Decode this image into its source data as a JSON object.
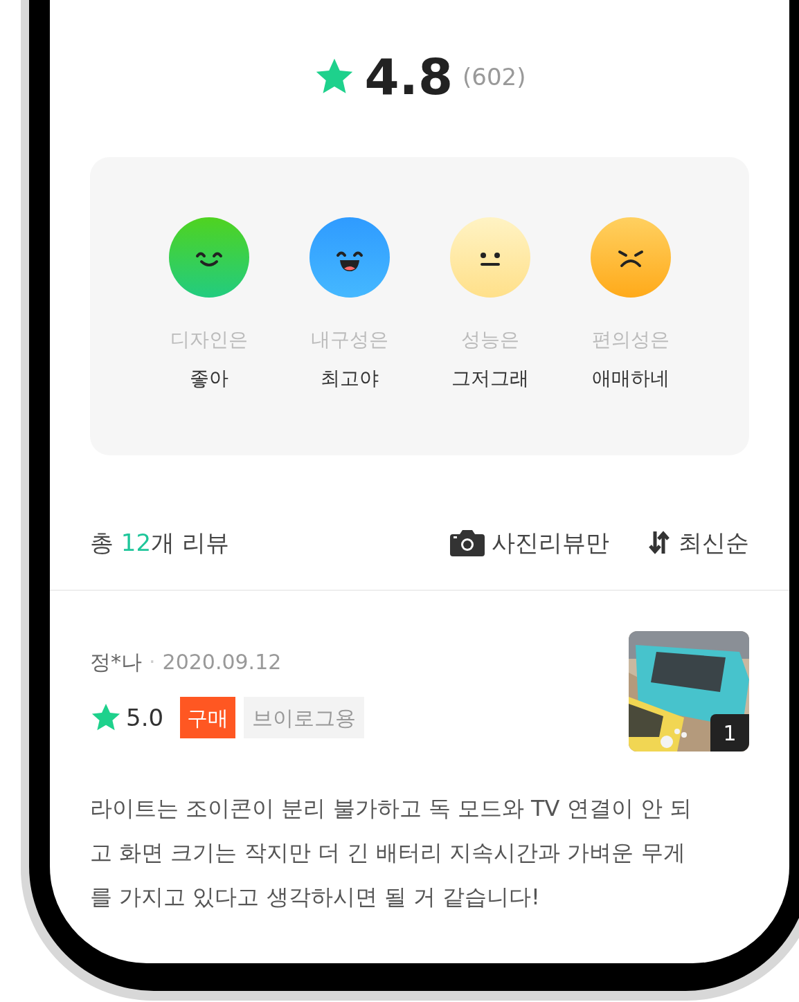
{
  "rating": {
    "score": "4.8",
    "count": "(602)"
  },
  "aspects": [
    {
      "kind": "smile",
      "label": "디자인은",
      "value": "좋아"
    },
    {
      "kind": "laugh",
      "label": "내구성은",
      "value": "최고야"
    },
    {
      "kind": "neutral",
      "label": "성능은",
      "value": "그저그래"
    },
    {
      "kind": "frown",
      "label": "편의성은",
      "value": "애매하네"
    }
  ],
  "summary": {
    "prefix": "총",
    "count": "12",
    "suffix": "개 리뷰",
    "photo_filter": "사진리뷰만",
    "sort": "최신순"
  },
  "reviews": [
    {
      "author": "정*나",
      "separator": "·",
      "date": "2020.09.12",
      "score": "5.0",
      "badge": "구매",
      "tag": "브이로그용",
      "photo": {
        "kind": "picture",
        "count": "1"
      },
      "text": "라이트는 조이콘이 분리 불가하고 독 모드와 TV 연결이 안 되고 화면 크기는 작지만 더 긴 배터리 지속시간과 가벼운 무게를 가지고 있다고 생각하시면 될 거 같습니다!"
    }
  ]
}
